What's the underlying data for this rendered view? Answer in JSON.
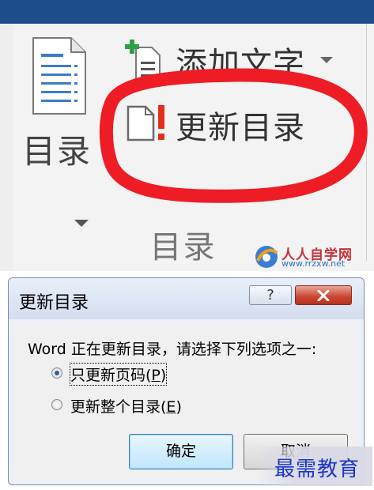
{
  "ribbon": {
    "toc_button_label": "目录",
    "add_text_label": "添加文字",
    "update_toc_label": "更新目录",
    "group_label": "目录"
  },
  "watermark_top": {
    "name": "人人自学网",
    "url": "www.rrzxw.net"
  },
  "dialog": {
    "title": "更新目录",
    "help_label": "?",
    "message": "Word 正在更新目录，请选择下列选项之一:",
    "options": [
      {
        "label": "只更新页码(",
        "key": "P",
        "suffix": ")",
        "checked": true
      },
      {
        "label": "更新整个目录(",
        "key": "E",
        "suffix": ")",
        "checked": false
      }
    ],
    "ok_label": "确定",
    "cancel_label": "取消"
  },
  "watermark_bottom": {
    "text": "最需教育"
  },
  "colors": {
    "title_bar": "#1d4d8a",
    "highlight_circle": "#ee1c24",
    "close_button": "#c9452f",
    "ok_border": "#3c7fb1",
    "watermark_bottom": "#1a35c4"
  }
}
